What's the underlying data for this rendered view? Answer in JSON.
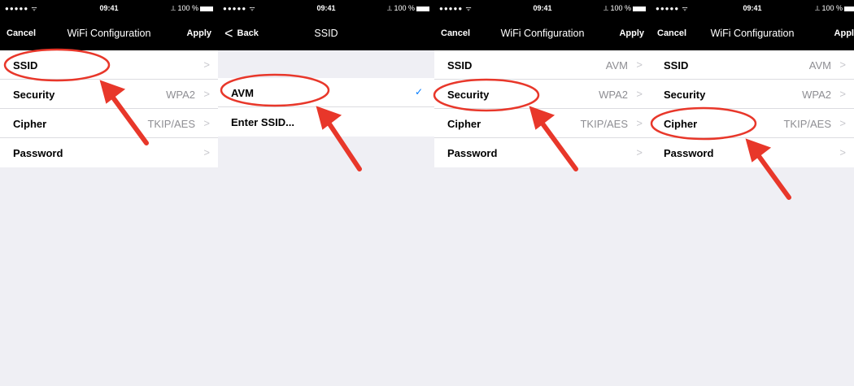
{
  "status": {
    "carrier": "●●●●● ᯤ",
    "time": "09:41",
    "battery": "⟂ 100 %"
  },
  "screens": [
    {
      "nav": {
        "left": "Cancel",
        "title": "WiFi Configuration",
        "right": "Apply"
      },
      "rows": [
        {
          "label": "SSID",
          "value": ""
        },
        {
          "label": "Security",
          "value": "WPA2"
        },
        {
          "label": "Cipher",
          "value": "TKIP/AES"
        },
        {
          "label": "Password",
          "value": ""
        }
      ]
    },
    {
      "nav": {
        "left": "Back",
        "title": "SSID",
        "right": ""
      },
      "rows": [
        {
          "label": "AVM",
          "selected": true
        },
        {
          "label": "Enter SSID..."
        }
      ]
    },
    {
      "nav": {
        "left": "Cancel",
        "title": "WiFi Configuration",
        "right": "Apply"
      },
      "rows": [
        {
          "label": "SSID",
          "value": "AVM"
        },
        {
          "label": "Security",
          "value": "WPA2"
        },
        {
          "label": "Cipher",
          "value": "TKIP/AES"
        },
        {
          "label": "Password",
          "value": ""
        }
      ]
    },
    {
      "nav": {
        "left": "Cancel",
        "title": "WiFi Configuration",
        "right": "Appl"
      },
      "rows": [
        {
          "label": "SSID",
          "value": "AVM"
        },
        {
          "label": "Security",
          "value": "WPA2"
        },
        {
          "label": "Cipher",
          "value": "TKIP/AES"
        },
        {
          "label": "Password",
          "value": ""
        }
      ]
    }
  ],
  "icons": {
    "chevron": "chevron-right-icon",
    "check": "checkmark-icon",
    "back": "chevron-left-icon"
  },
  "colors": {
    "annotation": "#e8372a",
    "selection": "#007aff",
    "nav_bar": "#000000",
    "secondary_text": "#8e8e93"
  }
}
